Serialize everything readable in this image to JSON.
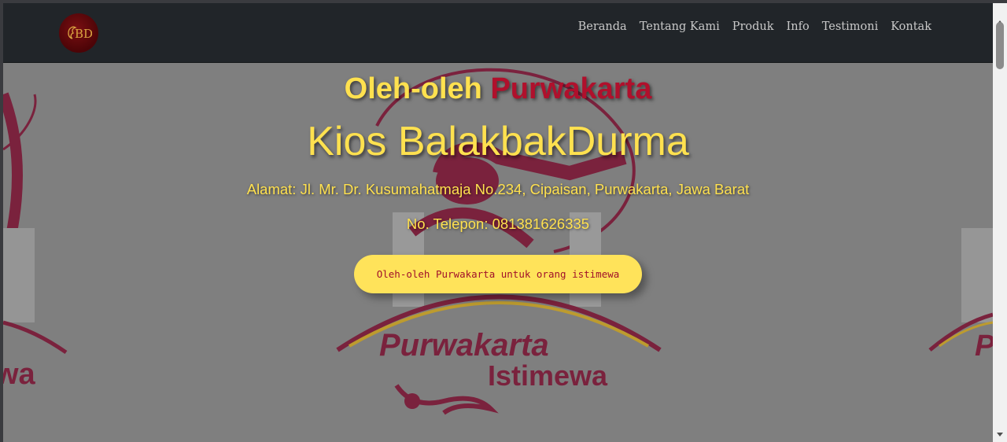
{
  "nav": {
    "logo_alt": "BD",
    "links": [
      "Beranda",
      "Tentang Kami",
      "Produk",
      "Info",
      "Testimoni",
      "Kontak"
    ]
  },
  "hero": {
    "subtitle_main": "Oleh-oleh",
    "subtitle_accent": "Purwakarta",
    "title": "Kios BalakbakDurma",
    "address": "Alamat: Jl. Mr. Dr. Kusumahatmaja No.234, Cipaisan, Purwakarta, Jawa Barat",
    "phone": "No. Telepon: 081381626335",
    "cta_label": "Oleh-oleh Purwakarta untuk orang istimewa",
    "bg_text_line1": "Purwakarta",
    "bg_text_line2": "Istimewa"
  },
  "colors": {
    "navbar": "#212529",
    "accent_yellow": "#ffe14f",
    "accent_red": "#b0102c",
    "hero_overlay": "#7f7f7f"
  }
}
